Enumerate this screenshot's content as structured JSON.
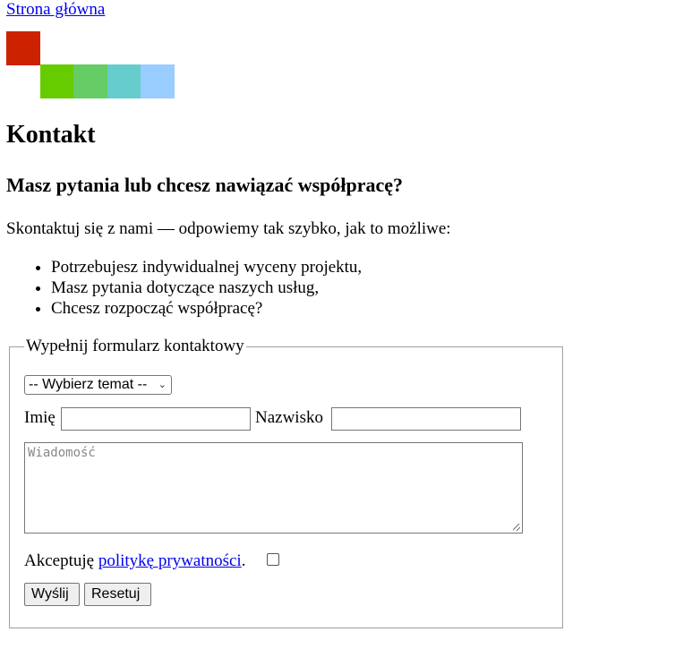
{
  "nav": {
    "home_link": "Strona główna"
  },
  "logo": {
    "colors": [
      "#cc2200",
      "#66cc00",
      "#66cc66",
      "#66cccc",
      "#99ccff"
    ]
  },
  "page": {
    "title": "Kontakt",
    "subtitle": "Masz pytania lub chcesz nawiązać współpracę?",
    "intro": "Skontaktuj się z nami — odpowiemy tak szybko, jak to możliwe:",
    "bullets": [
      "Potrzebujesz indywidualnej wyceny projektu,",
      "Masz pytania dotyczące naszych usług,",
      "Chcesz rozpocząć współpracę?"
    ]
  },
  "form": {
    "legend": "Wypełnij formularz kontaktowy",
    "topic_select": {
      "selected": "-- Wybierz temat --"
    },
    "first_name": {
      "label": "Imię",
      "value": ""
    },
    "last_name": {
      "label": "Nazwisko",
      "value": ""
    },
    "message": {
      "placeholder": "Wiadomość",
      "value": ""
    },
    "consent": {
      "prefix": "Akceptuję ",
      "link_text": "politykę prywatności",
      "suffix": ".",
      "checked": false
    },
    "buttons": {
      "send": "Wyślij",
      "reset": "Resetuj"
    }
  }
}
